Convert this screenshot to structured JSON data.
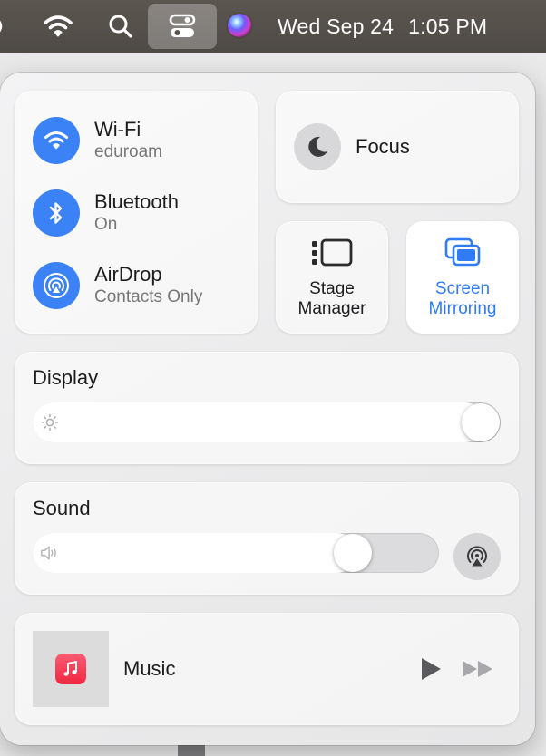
{
  "menubar": {
    "date": "Wed Sep 24",
    "time": "1:05 PM",
    "icons": [
      "partial-icon",
      "wifi-icon",
      "search-icon",
      "control-center-icon",
      "siri-icon"
    ]
  },
  "control_center": {
    "network": {
      "wifi": {
        "title": "Wi-Fi",
        "subtitle": "eduroam",
        "icon": "wifi-icon"
      },
      "bluetooth": {
        "title": "Bluetooth",
        "subtitle": "On",
        "icon": "bluetooth-icon"
      },
      "airdrop": {
        "title": "AirDrop",
        "subtitle": "Contacts Only",
        "icon": "airdrop-icon"
      }
    },
    "focus": {
      "label": "Focus",
      "icon": "moon-icon"
    },
    "stage_manager": {
      "line1": "Stage",
      "line2": "Manager",
      "icon": "stage-manager-icon"
    },
    "screen_mirroring": {
      "line1": "Screen",
      "line2": "Mirroring",
      "icon": "screen-mirroring-icon"
    },
    "display": {
      "heading": "Display",
      "brightness_fraction": 1.0,
      "icon": "sun-icon"
    },
    "sound": {
      "heading": "Sound",
      "volume_fraction": 0.82,
      "icon": "speaker-icon",
      "airplay_icon": "airplay-audio-icon"
    },
    "music": {
      "label": "Music",
      "app_icon": "music-note-icon"
    }
  },
  "colors": {
    "accent_blue": "#3b82f6",
    "mirroring_text": "#2f7cf6",
    "music_icon": "#f0263f"
  }
}
